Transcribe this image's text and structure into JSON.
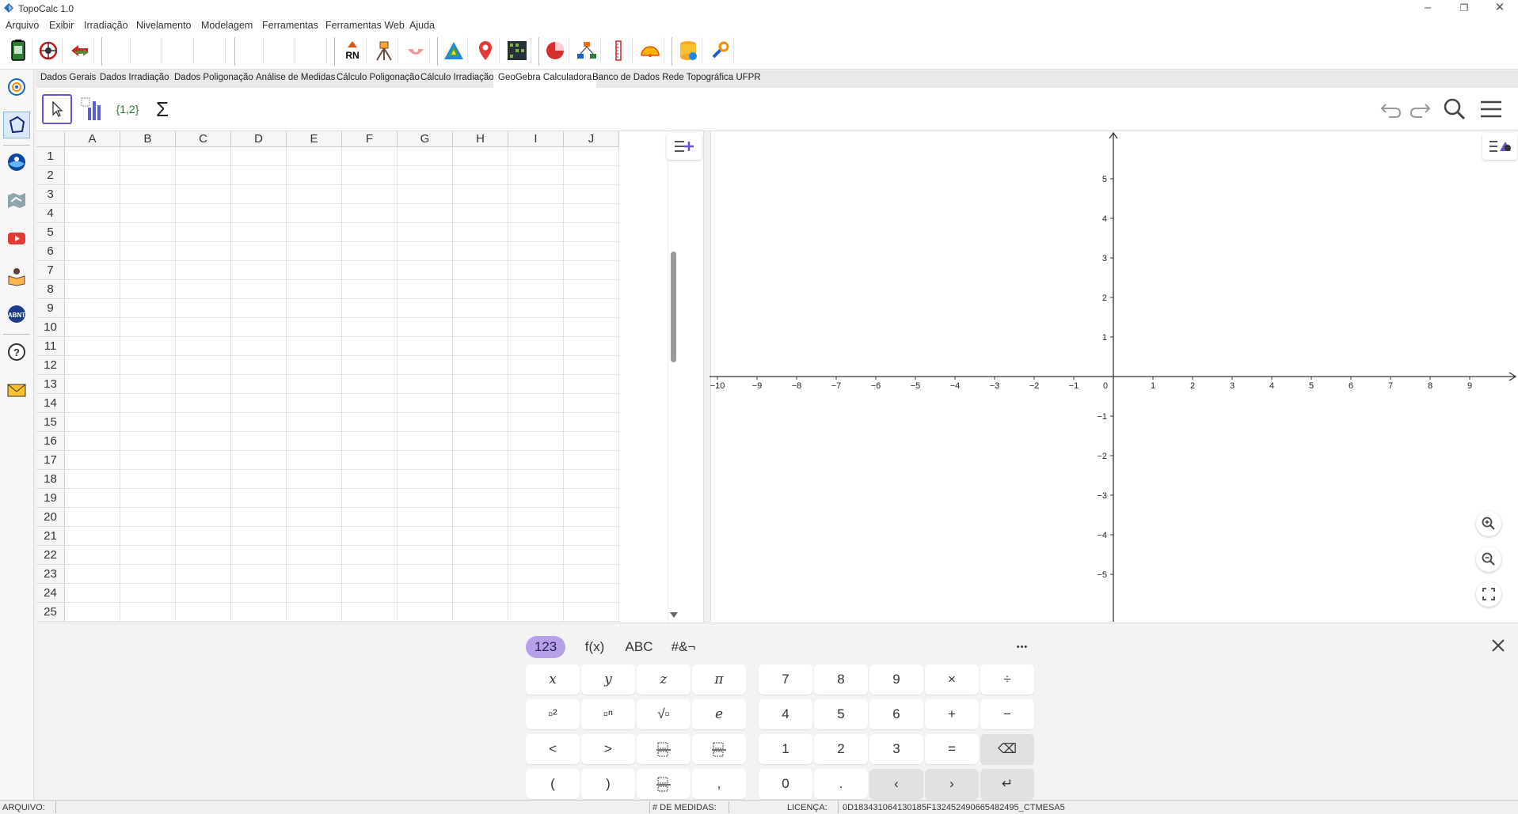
{
  "window": {
    "title": "TopoCalc 1.0"
  },
  "menu": [
    "Arquivo",
    "Exibir",
    "Irradiação",
    "Nivelamento",
    "Modelagem",
    "Ferramentas",
    "Ferramentas Web",
    "Ajuda"
  ],
  "toolbar": {
    "rn_label": "RN"
  },
  "tabs": [
    "Dados Gerais",
    "Dados Irradiação",
    "Dados Poligonação",
    "Análise de Medidas",
    "Cálculo Poligonação",
    "Cálculo Irradiação",
    "GeoGebra Calculadora",
    "Banco de Dados Rede Topográfica UFPR"
  ],
  "active_tab": "GeoGebra Calculadora",
  "ggb_toolbar": {
    "list_tool_label": "{1,2}",
    "sum_tool_label": "Σ"
  },
  "spreadsheet": {
    "columns": [
      "A",
      "B",
      "C",
      "D",
      "E",
      "F",
      "G",
      "H",
      "I",
      "J"
    ],
    "rows": [
      "1",
      "2",
      "3",
      "4",
      "5",
      "6",
      "7",
      "8",
      "9",
      "10",
      "11",
      "12",
      "13",
      "14",
      "15",
      "16",
      "17",
      "18",
      "19",
      "20",
      "21",
      "22",
      "23",
      "24",
      "25"
    ]
  },
  "graphics": {
    "x_ticks": [
      "−10",
      "−9",
      "−8",
      "−7",
      "−6",
      "−5",
      "−4",
      "−3",
      "−2",
      "−1",
      "0",
      "1",
      "2",
      "3",
      "4",
      "5",
      "6",
      "7",
      "8",
      "9"
    ],
    "y_ticks_pos": [
      "5",
      "4",
      "3",
      "2",
      "1"
    ],
    "y_ticks_neg": [
      "−1",
      "−2",
      "−3",
      "−4",
      "−5"
    ]
  },
  "keyboard": {
    "tabs": [
      "123",
      "f(x)",
      "ABC",
      "#&¬"
    ],
    "more": "•••",
    "left_keys": [
      "x",
      "y",
      "z",
      "π",
      "▫²",
      "▫ⁿ",
      "√▫",
      "e",
      "<",
      ">",
      "",
      "",
      "(",
      ")",
      "",
      ","
    ],
    "num_keys": [
      "7",
      "8",
      "9",
      "×",
      "÷",
      "4",
      "5",
      "6",
      "+",
      "−",
      "1",
      "2",
      "3",
      "=",
      "⌫",
      "0",
      ".",
      "‹",
      "›",
      "↵"
    ]
  },
  "status": {
    "arquivo_label": "ARQUIVO:",
    "medidas_label": "# DE MEDIDAS:",
    "licenca_label": "LICENÇA:",
    "licenca_value": "0D183431064130185F132452490665482495_CTMESA5"
  },
  "colors": {
    "accent": "#6557d2",
    "selected_tab": "#b4a1e8"
  }
}
